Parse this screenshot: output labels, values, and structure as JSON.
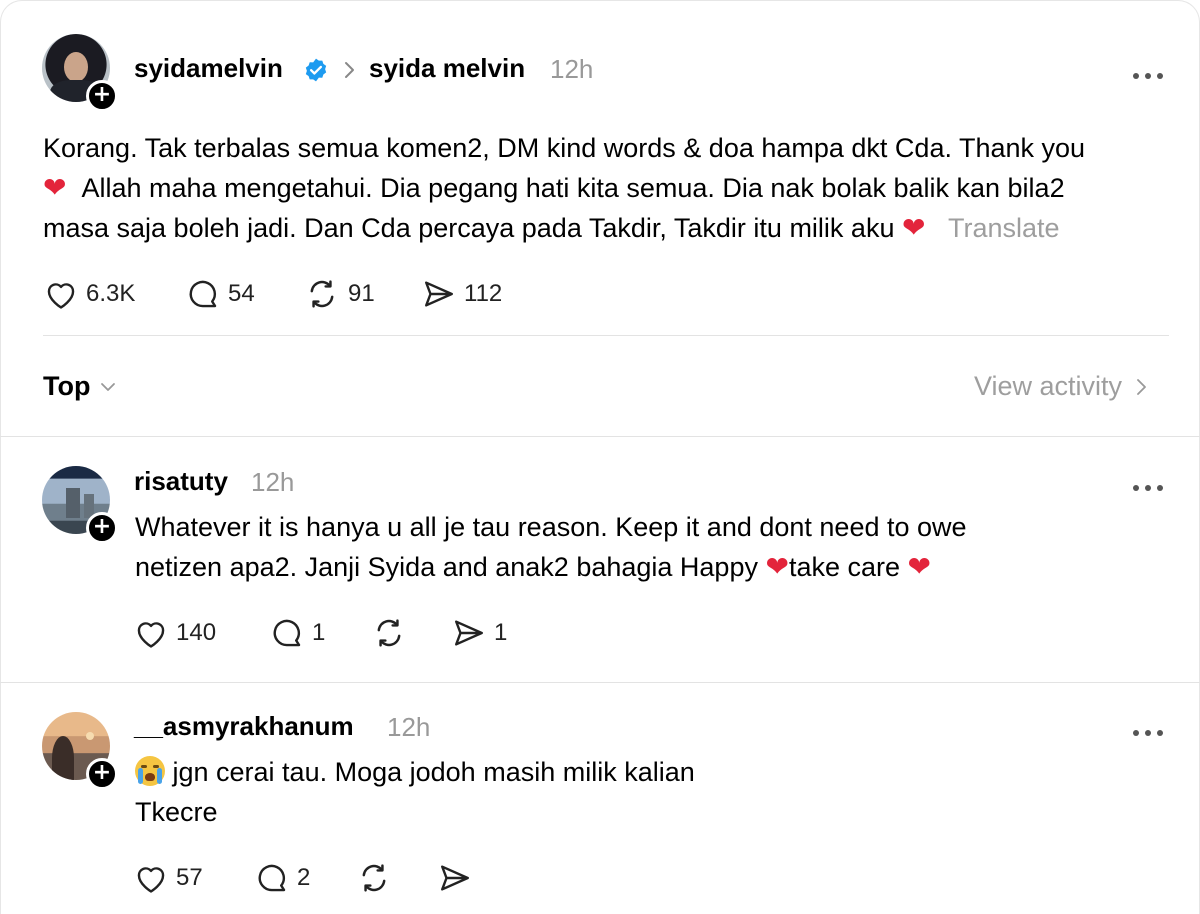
{
  "post": {
    "username": "syidamelvin",
    "reply_to": "syida melvin",
    "time": "12h",
    "text_line1": "Korang. Tak terbalas semua komen2, DM kind words & doa hampa dkt Cda. Thank you",
    "text_line2": "Allah maha mengetahui. Dia pegang hati kita semua. Dia nak bolak balik kan bila2",
    "text_line3": "masa saja boleh jadi. Dan Cda percaya pada Takdir, Takdir itu milik aku",
    "translate": "Translate",
    "likes": "6.3K",
    "comments": "54",
    "reposts": "91",
    "shares": "112"
  },
  "sort": {
    "label": "Top",
    "view_activity": "View activity"
  },
  "replies": [
    {
      "username": "risatuty",
      "time": "12h",
      "line1": "Whatever it is hanya u all je tau reason. Keep it and dont need to owe",
      "line2_a": "netizen apa2. Janji Syida and anak2 bahagia Happy ",
      "line2_b": "take care ",
      "likes": "140",
      "comments": "1",
      "reposts": "",
      "shares": "1"
    },
    {
      "username": "__asmyrakhanum",
      "time": "12h",
      "line1": " jgn cerai tau. Moga jodoh masih milik kalian",
      "line2": "Tkecre",
      "likes": "57",
      "comments": "2",
      "reposts": "",
      "shares": ""
    }
  ],
  "icons": {
    "verified": "verified-badge-icon",
    "chevron": "chevron-right-icon",
    "heart_emoji": "red-heart-emoji",
    "crying_emoji": "crying-face-emoji"
  },
  "colors": {
    "verified_blue": "#1d9bf0",
    "heart_red": "#e3243b",
    "muted_gray": "#999999"
  }
}
